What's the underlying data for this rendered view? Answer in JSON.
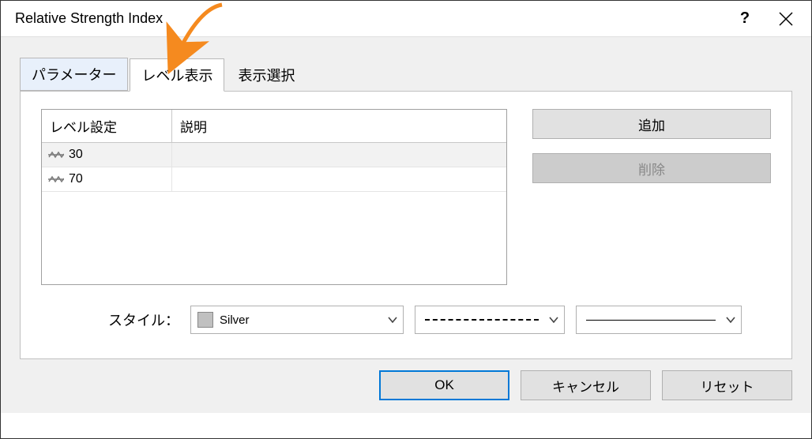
{
  "window": {
    "title": "Relative Strength Index"
  },
  "tabs": {
    "parameters": "パラメーター",
    "levels": "レベル表示",
    "display": "表示選択"
  },
  "grid": {
    "header_level": "レベル設定",
    "header_desc": "説明",
    "rows": [
      {
        "value": "30",
        "desc": ""
      },
      {
        "value": "70",
        "desc": ""
      }
    ]
  },
  "side": {
    "add": "追加",
    "delete": "削除"
  },
  "style": {
    "label": "スタイル：",
    "color_name": "Silver",
    "color_hex": "#c0c0c0"
  },
  "buttons": {
    "ok": "OK",
    "cancel": "キャンセル",
    "reset": "リセット"
  }
}
